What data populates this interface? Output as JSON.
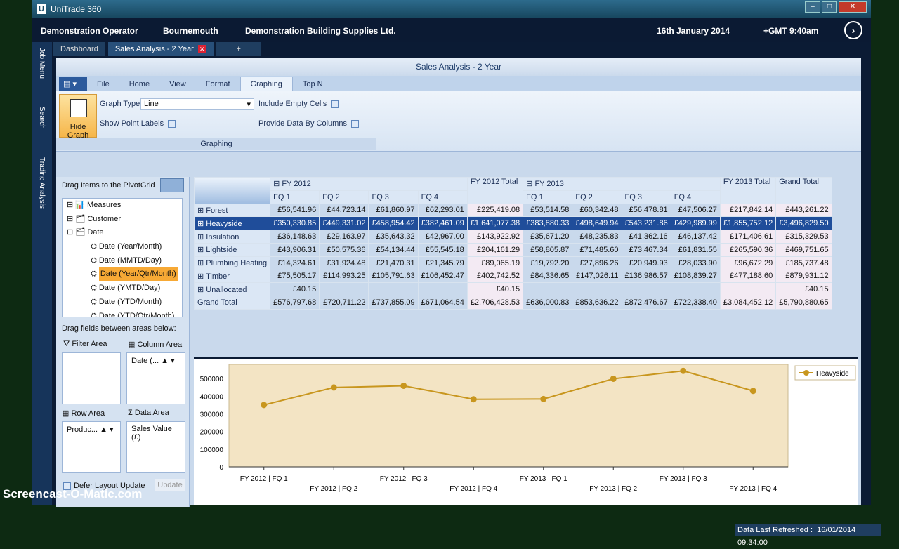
{
  "window": {
    "title": "UniTrade 360",
    "min": "–",
    "max": "□",
    "close": "✕"
  },
  "header": {
    "operator": "Demonstration Operator",
    "branch": "Bournemouth",
    "company": "Demonstration Building Supplies Ltd.",
    "date": "16th January 2014",
    "time": "+GMT 9:40am"
  },
  "sidebar": {
    "items": [
      "Job Menu",
      "Search",
      "Trading Analysis"
    ]
  },
  "tabs": [
    {
      "label": "Dashboard"
    },
    {
      "label": "Sales Analysis - 2 Year"
    },
    {
      "label": "+"
    }
  ],
  "inner": {
    "title": "Sales Analysis - 2 Year"
  },
  "ribbon": {
    "tabs": [
      "File",
      "Home",
      "View",
      "Format",
      "Graphing",
      "Top N"
    ],
    "hide_graph": "Hide Graph",
    "graph_type_label": "Graph Type",
    "graph_type_value": "Line",
    "show_point_labels": "Show Point Labels",
    "include_empty": "Include Empty Cells",
    "provide_by_columns": "Provide Data By Columns",
    "group": "Graphing"
  },
  "fieldlist": {
    "title": "Drag Items to the PivotGrid",
    "items": [
      "Measures",
      "Customer",
      "Date",
      "Date (Year/Month)",
      "Date (MMTD/Day)",
      "Date (Year/Qtr/Month)",
      "Date (YMTD/Day)",
      "Date (YTD/Month)",
      "Date (YTD/Qtr/Month)"
    ],
    "drag_areas": "Drag fields between areas below:",
    "filter_area": "Filter Area",
    "column_area": "Column Area",
    "row_area": "Row Area",
    "data_area": "Data Area",
    "column_field": "Date (...",
    "row_field": "Produc...",
    "data_field": "Sales Value (£)",
    "defer": "Defer Layout Update",
    "update": "Update"
  },
  "grid": {
    "year_headers": [
      "FY 2012",
      "FY 2012 Total",
      "FY 2013",
      "FY 2013 Total",
      "Grand Total"
    ],
    "quarters": [
      "FQ 1",
      "FQ 2",
      "FQ 3",
      "FQ 4"
    ],
    "rows": [
      {
        "name": "Forest",
        "v": [
          "£56,541.96",
          "£44,723.14",
          "£61,860.97",
          "£62,293.01",
          "£225,419.08",
          "£53,514.58",
          "£60,342.48",
          "£56,478.81",
          "£47,506.27",
          "£217,842.14",
          "£443,261.22"
        ]
      },
      {
        "name": "Heavyside",
        "v": [
          "£350,330.85",
          "£449,331.02",
          "£458,954.42",
          "£382,461.09",
          "£1,641,077.38",
          "£383,880.33",
          "£498,649.94",
          "£543,231.86",
          "£429,989.99",
          "£1,855,752.12",
          "£3,496,829.50"
        ]
      },
      {
        "name": "Insulation",
        "v": [
          "£36,148.63",
          "£29,163.97",
          "£35,643.32",
          "£42,967.00",
          "£143,922.92",
          "£35,671.20",
          "£48,235.83",
          "£41,362.16",
          "£46,137.42",
          "£171,406.61",
          "£315,329.53"
        ]
      },
      {
        "name": "Lightside",
        "v": [
          "£43,906.31",
          "£50,575.36",
          "£54,134.44",
          "£55,545.18",
          "£204,161.29",
          "£58,805.87",
          "£71,485.60",
          "£73,467.34",
          "£61,831.55",
          "£265,590.36",
          "£469,751.65"
        ]
      },
      {
        "name": "Plumbing Heating",
        "v": [
          "£14,324.61",
          "£31,924.48",
          "£21,470.31",
          "£21,345.79",
          "£89,065.19",
          "£19,792.20",
          "£27,896.26",
          "£20,949.93",
          "£28,033.90",
          "£96,672.29",
          "£185,737.48"
        ]
      },
      {
        "name": "Timber",
        "v": [
          "£75,505.17",
          "£114,993.25",
          "£105,791.63",
          "£106,452.47",
          "£402,742.52",
          "£84,336.65",
          "£147,026.11",
          "£136,986.57",
          "£108,839.27",
          "£477,188.60",
          "£879,931.12"
        ]
      },
      {
        "name": "Unallocated",
        "v": [
          "£40.15",
          "",
          "",
          "",
          "£40.15",
          "",
          "",
          "",
          "",
          "",
          "£40.15"
        ]
      },
      {
        "name": "Grand Total",
        "v": [
          "£576,797.68",
          "£720,711.22",
          "£737,855.09",
          "£671,064.54",
          "£2,706,428.53",
          "£636,000.83",
          "£853,636.22",
          "£872,476.67",
          "£722,338.40",
          "£3,084,452.12",
          "£5,790,880.65"
        ]
      }
    ]
  },
  "chart_data": {
    "type": "line",
    "x": [
      "FY 2012 | FQ 1",
      "FY 2012 | FQ 2",
      "FY 2012 | FQ 3",
      "FY 2012 | FQ 4",
      "FY 2013 | FQ 1",
      "FY 2013 | FQ 2",
      "FY 2013 | FQ 3",
      "FY 2013 | FQ 4"
    ],
    "series": [
      {
        "name": "Heavyside",
        "values": [
          350330.85,
          449331.02,
          458954.42,
          382461.09,
          383880.33,
          498649.94,
          543231.86,
          429989.99
        ]
      }
    ],
    "yticks": [
      "0",
      "100000",
      "200000",
      "300000",
      "400000",
      "500000"
    ],
    "ylim": [
      0,
      580000
    ],
    "color": "#c8961e"
  },
  "status": {
    "label": "Data Last Refreshed :",
    "value": "16/01/2014 09:34:00"
  },
  "watermark": "Screencast-O-Matic.com"
}
